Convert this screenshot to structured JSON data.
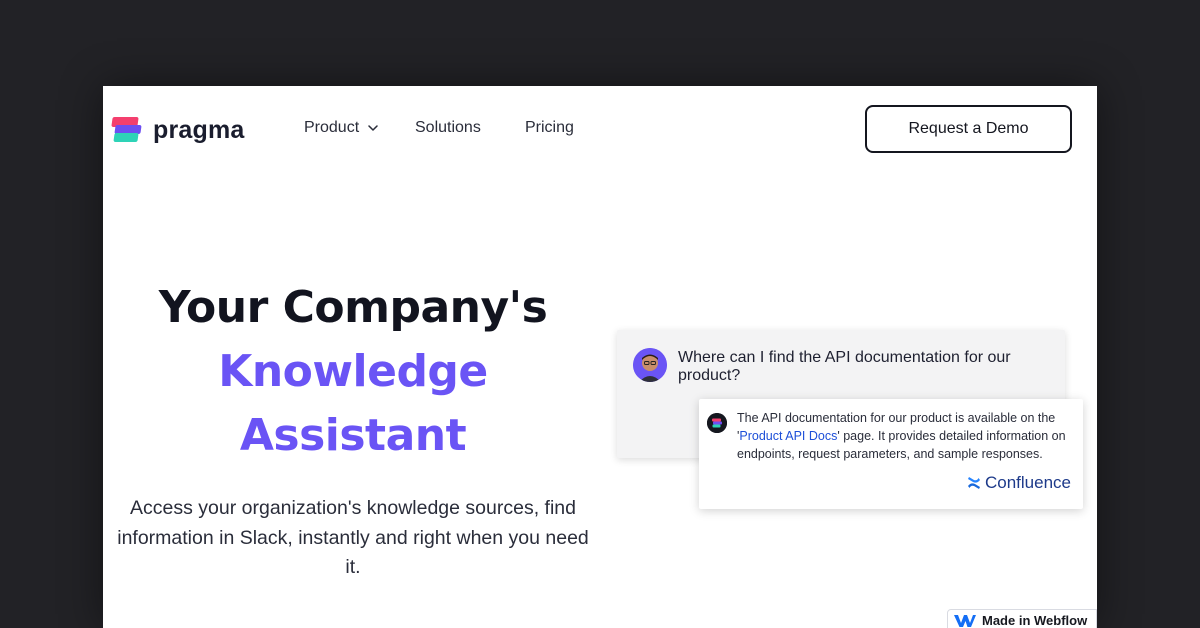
{
  "nav": {
    "brand": "pragma",
    "items": [
      {
        "label": "Product",
        "has_dropdown": true
      },
      {
        "label": "Solutions"
      },
      {
        "label": "Pricing"
      }
    ],
    "cta": "Request a Demo"
  },
  "hero": {
    "title_line1": "Your Company's",
    "title_accent1": "Knowledge",
    "title_accent2": "Assistant",
    "subtitle": "Access your organization's knowledge sources, find information in Slack, instantly and right when you need it."
  },
  "chat": {
    "question": "Where can I find the API documentation for our product?",
    "answer_before": "The API documentation for our product is available on the '",
    "answer_link": "Product API Docs",
    "answer_after": "' page. It provides detailed information on endpoints, request parameters, and sample responses.",
    "source": "Confluence"
  },
  "badge": {
    "label": "Made in Webflow"
  },
  "colors": {
    "accent": "#6a54f5",
    "background": "#222226",
    "text": "#12141f"
  }
}
